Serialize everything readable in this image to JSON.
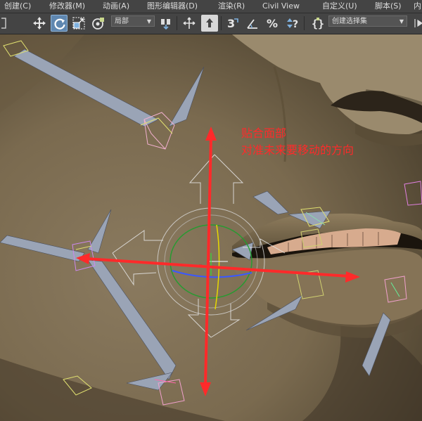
{
  "menubar": {
    "items": [
      {
        "label": "创建(C)"
      },
      {
        "label": "修改器(M)"
      },
      {
        "label": "动画(A)"
      },
      {
        "label": "图形编辑器(D)"
      },
      {
        "label": "渲染(R)"
      },
      {
        "label": "Civil View"
      },
      {
        "label": "自定义(U)"
      },
      {
        "label": "脚本(S)"
      },
      {
        "label": "内"
      }
    ]
  },
  "toolbar": {
    "coordinate_system": "局部",
    "selection_set_placeholder": "创建选择集",
    "active_tool": "rotate",
    "accent_color": "#5f87b0"
  },
  "viewport": {
    "annotation": {
      "line1": "贴合面部",
      "line2": "对准未来要移动的方向",
      "color": "#ff2a2a"
    },
    "background_color": "#7d6d52"
  }
}
